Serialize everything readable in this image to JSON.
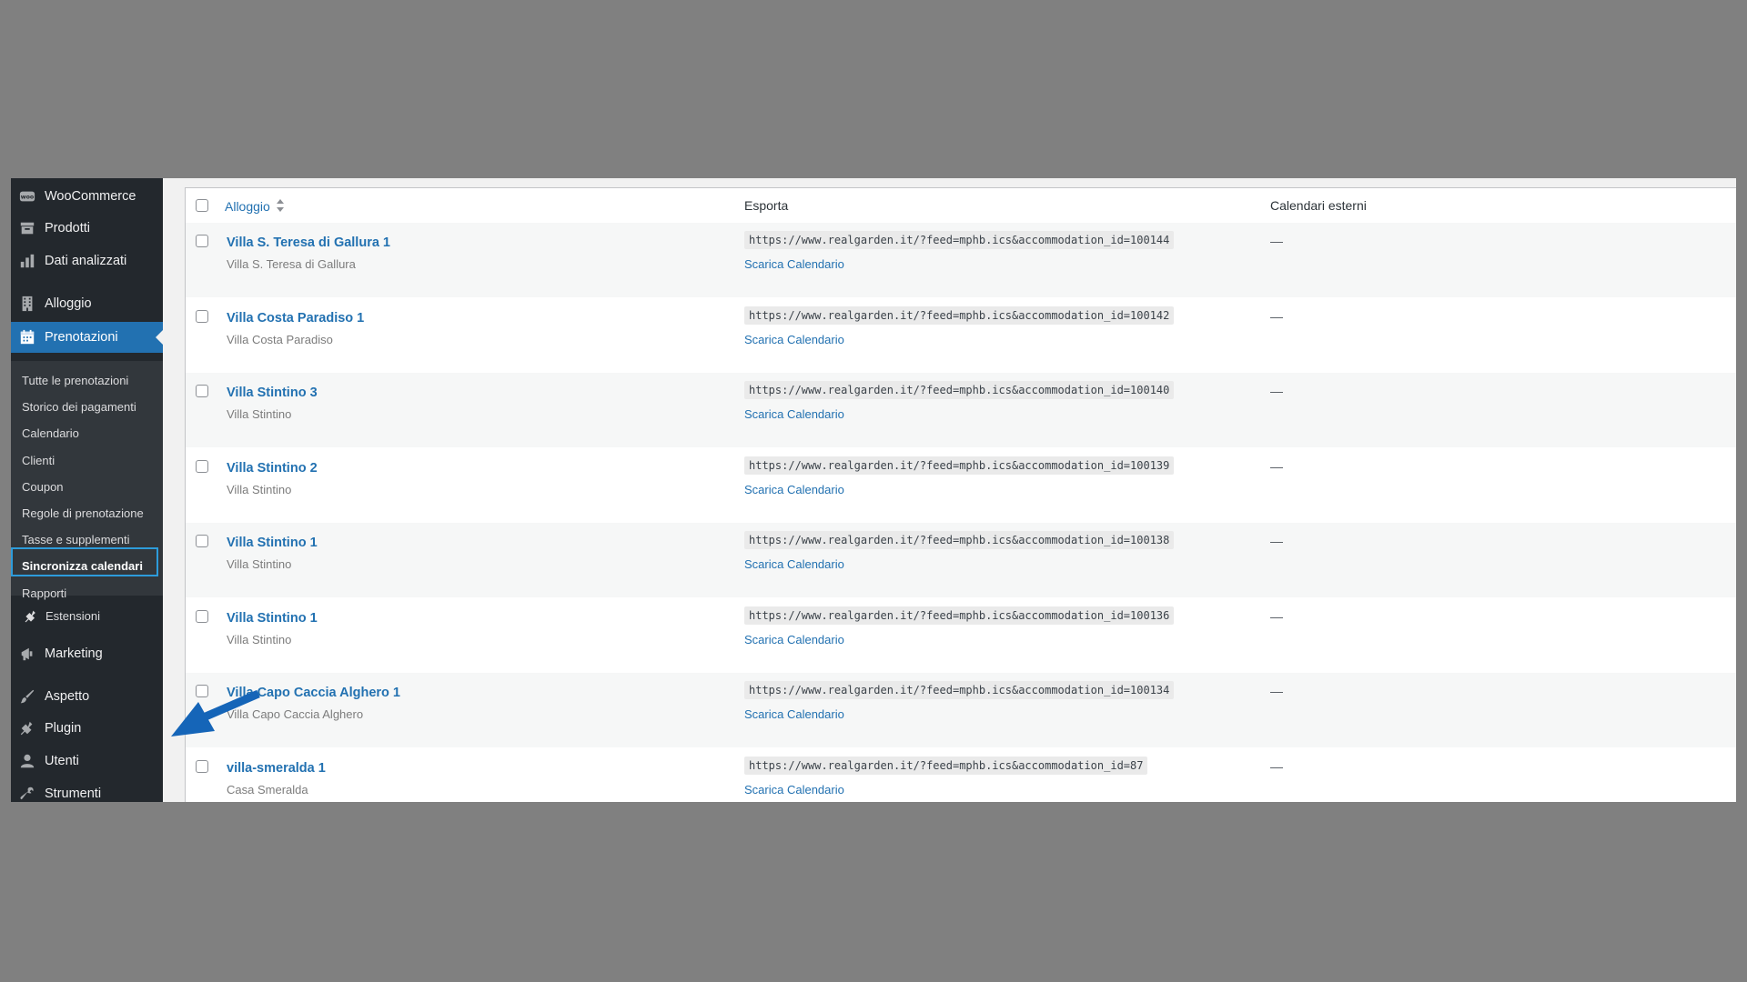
{
  "sidebar": {
    "top_items": [
      {
        "label": "WooCommerce",
        "icon": "woocommerce-icon"
      },
      {
        "label": "Prodotti",
        "icon": "archive-icon"
      },
      {
        "label": "Dati analizzati",
        "icon": "bar-chart-icon"
      },
      {
        "label": "Alloggio",
        "icon": "building-icon"
      },
      {
        "label": "Prenotazioni",
        "icon": "calendar-icon",
        "current": true
      }
    ],
    "submenu": [
      {
        "label": "Tutte le prenotazioni"
      },
      {
        "label": "Storico dei pagamenti"
      },
      {
        "label": "Calendario"
      },
      {
        "label": "Clienti"
      },
      {
        "label": "Coupon"
      },
      {
        "label": "Regole di prenotazione"
      },
      {
        "label": "Tasse e supplementi"
      },
      {
        "label": "Sincronizza calendari",
        "current": true
      },
      {
        "label": "Rapporti"
      },
      {
        "label": "Estensioni",
        "icon": "plugin-icon"
      }
    ],
    "bottom_items": [
      {
        "label": "Marketing",
        "icon": "megaphone-icon"
      },
      {
        "label": "Aspetto",
        "icon": "brush-icon"
      },
      {
        "label": "Plugin",
        "icon": "plugin-icon"
      },
      {
        "label": "Utenti",
        "icon": "user-icon"
      },
      {
        "label": "Strumenti",
        "icon": "wrench-icon"
      }
    ]
  },
  "table": {
    "columns": {
      "alloggio": "Alloggio",
      "esporta": "Esporta",
      "esterni": "Calendari esterni"
    },
    "download_label": "Scarica Calendario",
    "empty_marker": "—",
    "rows": [
      {
        "title": "Villa S. Teresa di Gallura 1",
        "subtitle": "Villa S. Teresa di Gallura",
        "url": "https://www.realgarden.it/?feed=mphb.ics&accommodation_id=100144"
      },
      {
        "title": "Villa Costa Paradiso 1",
        "subtitle": "Villa Costa Paradiso",
        "url": "https://www.realgarden.it/?feed=mphb.ics&accommodation_id=100142"
      },
      {
        "title": "Villa Stintino 3",
        "subtitle": "Villa Stintino",
        "url": "https://www.realgarden.it/?feed=mphb.ics&accommodation_id=100140"
      },
      {
        "title": "Villa Stintino 2",
        "subtitle": "Villa Stintino",
        "url": "https://www.realgarden.it/?feed=mphb.ics&accommodation_id=100139"
      },
      {
        "title": "Villa Stintino 1",
        "subtitle": "Villa Stintino",
        "url": "https://www.realgarden.it/?feed=mphb.ics&accommodation_id=100138"
      },
      {
        "title": "Villa Stintino 1",
        "subtitle": "Villa Stintino",
        "url": "https://www.realgarden.it/?feed=mphb.ics&accommodation_id=100136"
      },
      {
        "title": "Villa Capo Caccia Alghero 1",
        "subtitle": "Villa Capo Caccia Alghero",
        "url": "https://www.realgarden.it/?feed=mphb.ics&accommodation_id=100134"
      },
      {
        "title": "villa-smeralda 1",
        "subtitle": "Casa Smeralda",
        "url": "https://www.realgarden.it/?feed=mphb.ics&accommodation_id=87"
      }
    ]
  },
  "colors": {
    "accent": "#2271b1",
    "sidebar_bg": "#23282d",
    "annotation_arrow": "#1565b8",
    "highlight_box": "#2d9cdb"
  }
}
